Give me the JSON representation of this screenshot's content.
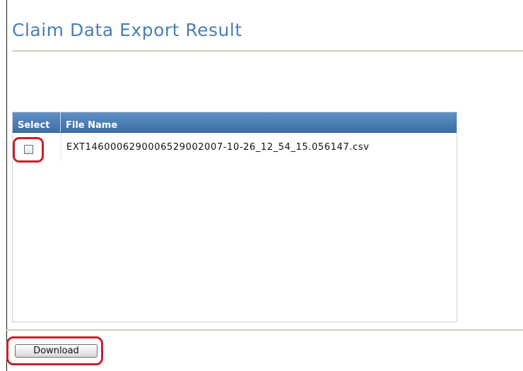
{
  "page": {
    "title": "Claim Data Export Result"
  },
  "grid": {
    "columns": [
      "Select",
      "File Name"
    ],
    "rows": [
      {
        "selected": false,
        "file_name": "EXT1460006290006529002007-10-26_12_54_15.056147.csv"
      }
    ]
  },
  "actions": {
    "download_label": "Download"
  },
  "colors": {
    "title": "#4a7fb5",
    "header": "#4a7cb3",
    "highlight": "#c8202c"
  }
}
